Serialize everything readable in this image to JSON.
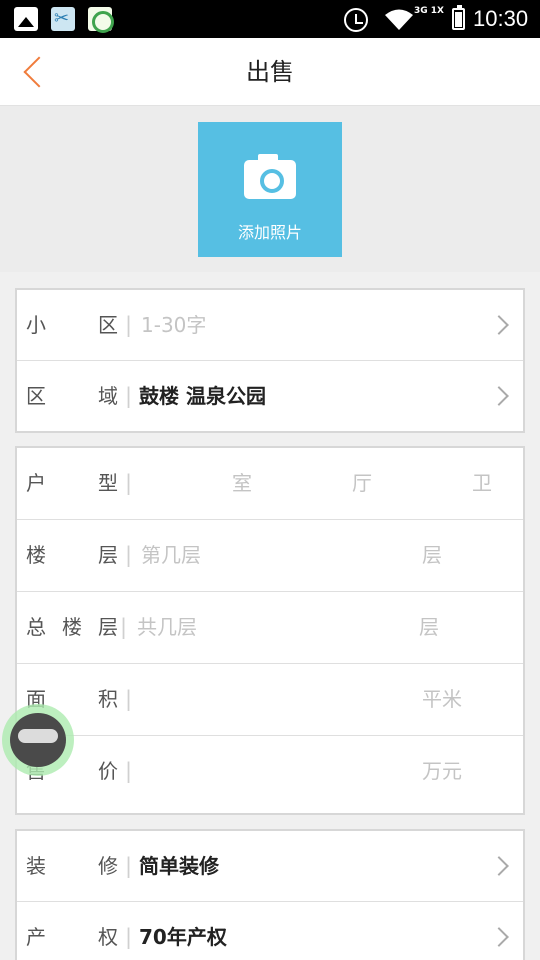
{
  "status_bar": {
    "time": "10:30",
    "network": "3G\n1X"
  },
  "header": {
    "title": "出售"
  },
  "photo": {
    "add_label": "添加照片"
  },
  "location": {
    "community": {
      "label": "小区",
      "placeholder": "1-30字"
    },
    "area": {
      "label": "区域",
      "value": "鼓楼 温泉公园"
    }
  },
  "details": {
    "layout": {
      "label": "户型",
      "units": [
        "室",
        "厅",
        "卫"
      ]
    },
    "floor": {
      "label": "楼层",
      "placeholder": "第几层",
      "unit": "层"
    },
    "total_floors": {
      "label": "总楼层",
      "placeholder": "共几层",
      "unit": "层"
    },
    "size": {
      "label": "面积",
      "unit": "平米"
    },
    "price": {
      "label": "售价",
      "unit": "万元"
    }
  },
  "extra": {
    "decoration": {
      "label": "装修",
      "value": "简单装修"
    },
    "property": {
      "label": "产权",
      "value": "70年产权"
    }
  },
  "colors": {
    "accent": "#f07c3c",
    "photo": "#56bfe3"
  }
}
